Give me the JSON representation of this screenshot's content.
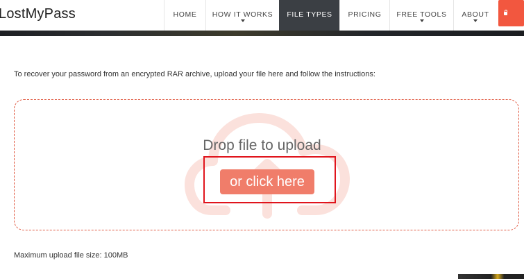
{
  "brand": {
    "logo_text": "LostMyPass"
  },
  "nav": {
    "items": [
      {
        "label": "HOME",
        "has_caret": false,
        "active": false
      },
      {
        "label": "HOW IT WORKS",
        "has_caret": true,
        "active": false
      },
      {
        "label": "FILE TYPES",
        "has_caret": false,
        "active": true
      },
      {
        "label": "PRICING",
        "has_caret": false,
        "active": false
      },
      {
        "label": "FREE TOOLS",
        "has_caret": true,
        "active": false
      },
      {
        "label": "ABOUT",
        "has_caret": true,
        "active": false
      }
    ],
    "cta_icon": "lock-icon"
  },
  "colors": {
    "accent": "#f2573f",
    "button": "#f07d6a",
    "active_nav": "#3b3f44",
    "highlight": "#e0141c"
  },
  "main": {
    "intro_text": "To recover your password from an encrypted RAR archive, upload your file here and follow the instructions:",
    "dropzone": {
      "title": "Drop file to upload",
      "button_label": "or click here",
      "background_icon": "cloud-upload-icon"
    },
    "max_size_text": "Maximum upload file size: 100MB"
  }
}
